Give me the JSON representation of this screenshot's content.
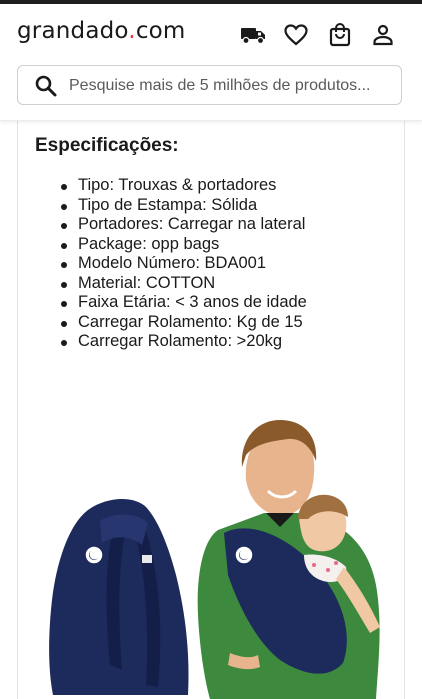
{
  "header": {
    "logo_left": "grandado",
    "logo_dot": ".",
    "logo_right": "com",
    "icons": [
      "truck-icon",
      "heart-icon",
      "bag-icon",
      "user-icon"
    ]
  },
  "search": {
    "placeholder": "Pesquise mais de 5 milhões de produtos..."
  },
  "specs": {
    "title": "Especificações:",
    "items": [
      "Tipo: Trouxas & portadores",
      "Tipo de Estampa: Sólida",
      "Portadores: Carregar na lateral",
      "Package: opp bags",
      "Modelo Número: BDA001",
      "Material: COTTON",
      "Faixa Etária: < 3 anos de idade",
      "Carregar Rolamento: Kg de 15",
      "Carregar Rolamento: >20kg"
    ]
  },
  "colors": {
    "accent_dot": "#e5343d",
    "carrier_navy": "#1d2a5c",
    "sweater_green": "#3d8a3f"
  }
}
